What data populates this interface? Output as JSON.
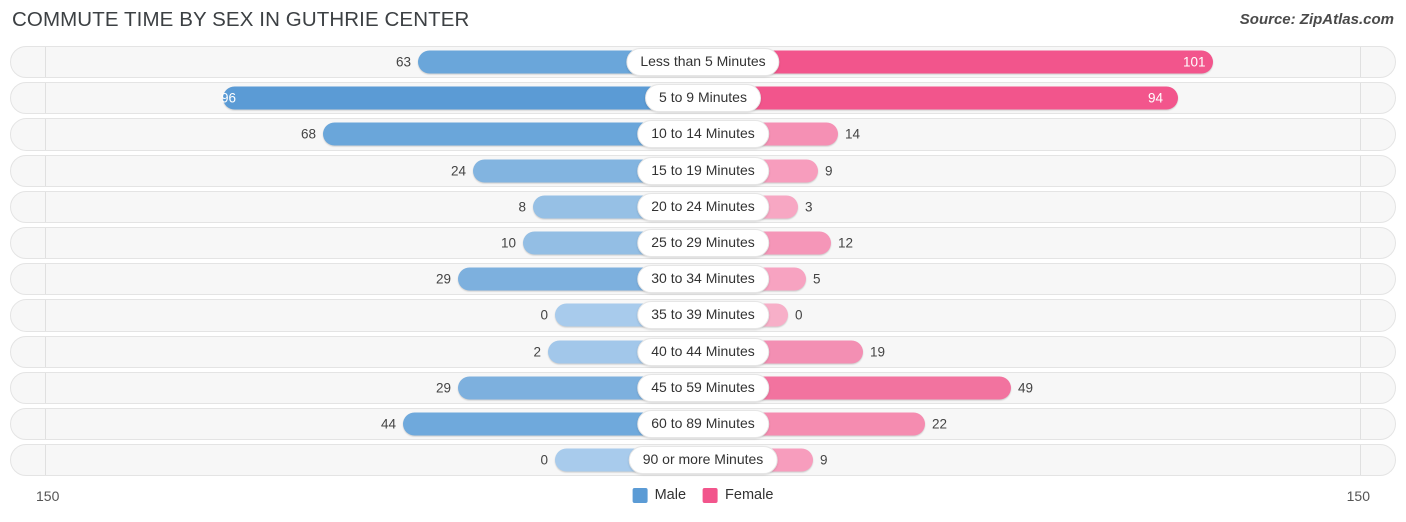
{
  "header": {
    "title": "COMMUTE TIME BY SEX IN GUTHRIE CENTER",
    "source": "Source: ZipAtlas.com"
  },
  "legend": {
    "items": [
      {
        "label": "Male",
        "color": "#5b9bd5"
      },
      {
        "label": "Female",
        "color": "#f2558c"
      }
    ]
  },
  "axis": {
    "left_max": "150",
    "right_max": "150"
  },
  "chart_data": {
    "type": "bar",
    "subtype": "diverging-horizontal-bar",
    "title": "COMMUTE TIME BY SEX IN GUTHRIE CENTER",
    "xlabel": "",
    "ylabel": "",
    "xlim": [
      0,
      150
    ],
    "grid": false,
    "legend_position": "bottom-center",
    "categories": [
      "Less than 5 Minutes",
      "5 to 9 Minutes",
      "10 to 14 Minutes",
      "15 to 19 Minutes",
      "20 to 24 Minutes",
      "25 to 29 Minutes",
      "30 to 34 Minutes",
      "35 to 39 Minutes",
      "40 to 44 Minutes",
      "45 to 59 Minutes",
      "60 to 89 Minutes",
      "90 or more Minutes"
    ],
    "series": [
      {
        "name": "Male",
        "color": "#5b9bd5",
        "direction": "left",
        "values": [
          63,
          96,
          68,
          24,
          8,
          10,
          29,
          0,
          2,
          29,
          44,
          0
        ]
      },
      {
        "name": "Female",
        "color": "#f2558c",
        "direction": "right",
        "values": [
          101,
          94,
          14,
          9,
          3,
          12,
          5,
          0,
          19,
          49,
          22,
          9
        ]
      }
    ]
  },
  "rows": [
    {
      "category": "Less than 5 Minutes",
      "male": "63",
      "female": "101",
      "male_w": 285,
      "female_w": 510,
      "male_inside": false,
      "female_inside": true,
      "male_color": "#6aa6da",
      "female_color": "#f2558c"
    },
    {
      "category": "5 to 9 Minutes",
      "male": "96",
      "female": "94",
      "male_w": 480,
      "female_w": 475,
      "male_inside": true,
      "female_inside": true,
      "male_color": "#5b9bd5",
      "female_color": "#f2558c"
    },
    {
      "category": "10 to 14 Minutes",
      "male": "68",
      "female": "14",
      "male_w": 380,
      "female_w": 135,
      "male_inside": false,
      "female_inside": false,
      "male_color": "#6aa6da",
      "female_color": "#f590b4"
    },
    {
      "category": "15 to 19 Minutes",
      "male": "24",
      "female": "9",
      "male_w": 230,
      "female_w": 115,
      "male_inside": false,
      "female_inside": false,
      "male_color": "#82b4e0",
      "female_color": "#f79dbd"
    },
    {
      "category": "20 to 24 Minutes",
      "male": "8",
      "female": "3",
      "male_w": 170,
      "female_w": 95,
      "male_inside": false,
      "female_inside": false,
      "male_color": "#96c0e5",
      "female_color": "#f7a7c3"
    },
    {
      "category": "25 to 29 Minutes",
      "male": "10",
      "female": "12",
      "male_w": 180,
      "female_w": 128,
      "male_inside": false,
      "female_inside": false,
      "male_color": "#93bee4",
      "female_color": "#f596b8"
    },
    {
      "category": "30 to 34 Minutes",
      "male": "29",
      "female": "5",
      "male_w": 245,
      "female_w": 103,
      "male_inside": false,
      "female_inside": false,
      "male_color": "#7db0de",
      "female_color": "#f7a3c1"
    },
    {
      "category": "35 to 39 Minutes",
      "male": "0",
      "female": "0",
      "male_w": 148,
      "female_w": 85,
      "male_inside": false,
      "female_inside": false,
      "male_color": "#a8cbec",
      "female_color": "#f7afc8"
    },
    {
      "category": "40 to 44 Minutes",
      "male": "2",
      "female": "19",
      "male_w": 155,
      "female_w": 160,
      "male_inside": false,
      "female_inside": false,
      "male_color": "#a2c7ea",
      "female_color": "#f38fb3"
    },
    {
      "category": "45 to 59 Minutes",
      "male": "29",
      "female": "49",
      "male_w": 245,
      "female_w": 308,
      "male_inside": false,
      "female_inside": false,
      "male_color": "#7db0de",
      "female_color": "#f2739f"
    },
    {
      "category": "60 to 89 Minutes",
      "male": "44",
      "female": "22",
      "male_w": 300,
      "female_w": 222,
      "male_inside": false,
      "female_inside": false,
      "male_color": "#6fa9dc",
      "female_color": "#f58cb0"
    },
    {
      "category": "90 or more Minutes",
      "male": "0",
      "female": "9",
      "male_w": 148,
      "female_w": 110,
      "male_inside": false,
      "female_inside": false,
      "male_color": "#a8cbec",
      "female_color": "#f79dbd"
    }
  ]
}
